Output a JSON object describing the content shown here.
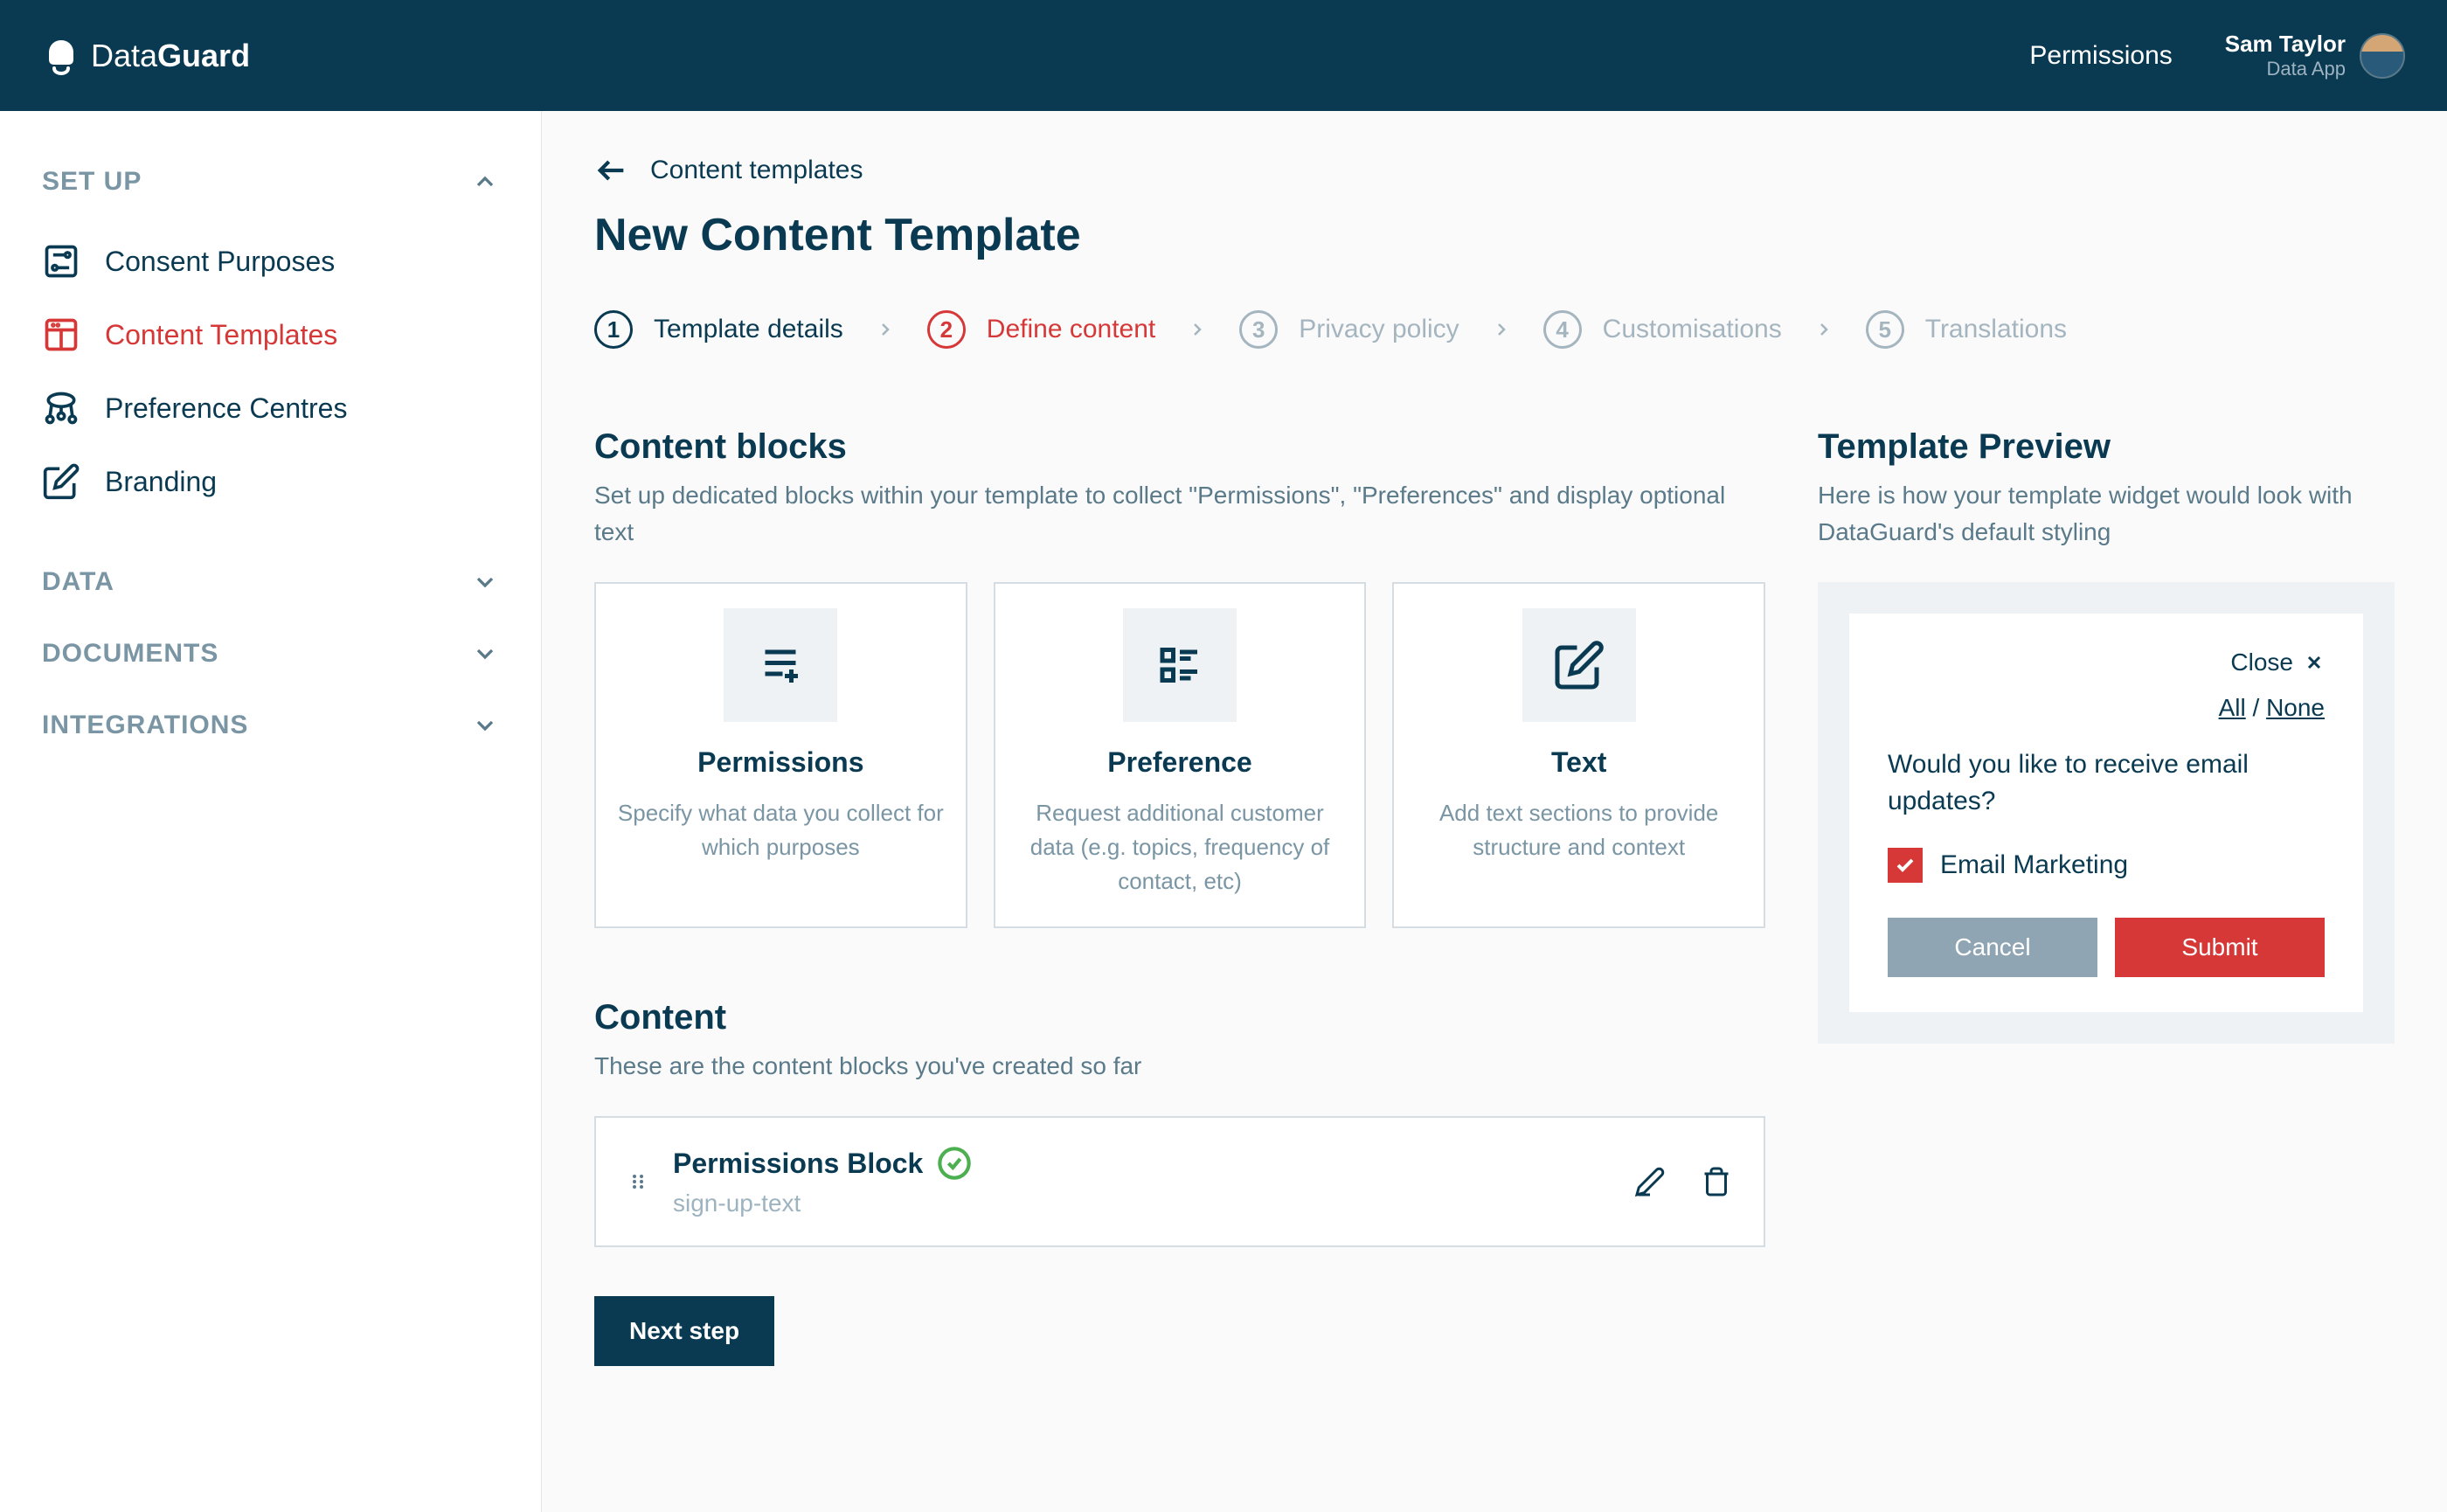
{
  "header": {
    "brand_prefix": "Data",
    "brand_suffix": "Guard",
    "nav_link": "Permissions",
    "user_name": "Sam Taylor",
    "user_app": "Data App"
  },
  "sidebar": {
    "sections": [
      {
        "title": "SET UP",
        "expanded": true,
        "items": [
          {
            "label": "Consent Purposes",
            "icon": "sliders"
          },
          {
            "label": "Content Templates",
            "icon": "layout",
            "active": true
          },
          {
            "label": "Preference Centres",
            "icon": "network"
          },
          {
            "label": "Branding",
            "icon": "edit"
          }
        ]
      },
      {
        "title": "DATA",
        "expanded": false
      },
      {
        "title": "DOCUMENTS",
        "expanded": false
      },
      {
        "title": "INTEGRATIONS",
        "expanded": false
      }
    ]
  },
  "breadcrumb": {
    "label": "Content templates"
  },
  "page_title": "New Content Template",
  "steps": [
    {
      "num": "1",
      "label": "Template details",
      "state": "done"
    },
    {
      "num": "2",
      "label": "Define content",
      "state": "active"
    },
    {
      "num": "3",
      "label": "Privacy policy",
      "state": "pending"
    },
    {
      "num": "4",
      "label": "Customisations",
      "state": "pending"
    },
    {
      "num": "5",
      "label": "Translations",
      "state": "pending"
    }
  ],
  "content_blocks": {
    "title": "Content blocks",
    "desc": "Set up dedicated blocks within your template to collect \"Permissions\", \"Preferences\" and display optional text",
    "cards": [
      {
        "title": "Permissions",
        "desc": "Specify what data you collect for which purposes"
      },
      {
        "title": "Preference",
        "desc": "Request additional customer data (e.g. topics, frequency of contact, etc)"
      },
      {
        "title": "Text",
        "desc": "Add text sections to provide structure and context"
      }
    ]
  },
  "content_list": {
    "title": "Content",
    "desc": "These are the content blocks you've created so far",
    "items": [
      {
        "title": "Permissions Block",
        "subtitle": "sign-up-text"
      }
    ]
  },
  "next_button": "Next step",
  "preview": {
    "title": "Template Preview",
    "desc": "Here is how your template widget would look with DataGuard's default styling",
    "close": "Close",
    "all": "All",
    "none": "None",
    "question": "Would you like to receive email updates?",
    "check_label": "Email Marketing",
    "cancel": "Cancel",
    "submit": "Submit"
  }
}
